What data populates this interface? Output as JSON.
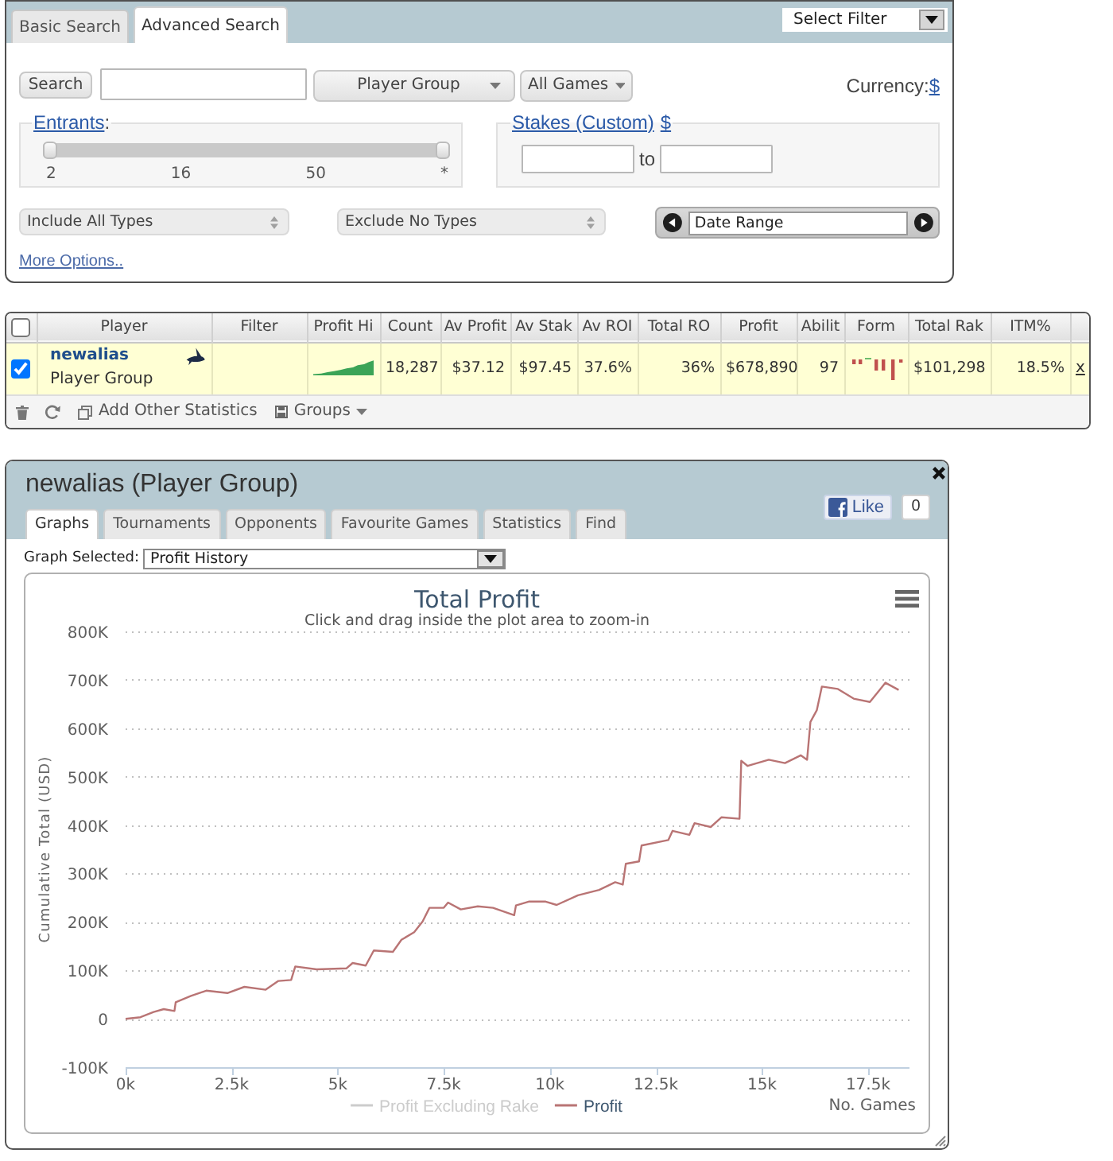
{
  "search_panel": {
    "tabs": [
      {
        "label": "Basic Search",
        "selected": false
      },
      {
        "label": "Advanced Search",
        "selected": true
      }
    ],
    "filter_select": "Select Filter",
    "search_button": "Search",
    "group_dropdown": "Player Group",
    "games_dropdown": "All Games",
    "currency": {
      "label": "Currency:",
      "link": "$"
    },
    "entrants": {
      "link": "Entrants",
      "suffix": ":",
      "handles": [
        {
          "level": 0
        },
        {
          "level": 1
        }
      ],
      "ticks": [
        "2",
        "16",
        "50",
        "*"
      ]
    },
    "stakes": {
      "link": "Stakes (Custom)",
      "currency_link": "$",
      "separator": "to"
    },
    "include_types": "Include All Types",
    "exclude_types": "Exclude No Types",
    "date_range": "Date Range",
    "more_options": "More Options.."
  },
  "stats_table": {
    "all_selected": false,
    "columns": [
      "Player",
      "Filter",
      "Profit Hi",
      "Count",
      "Av Profit",
      "Av Stak",
      "Av ROI",
      "Total RO",
      "Profit",
      "Abilit",
      "Form",
      "Total Rak",
      "ITM%"
    ],
    "rows": [
      {
        "selected": true,
        "cells": [
          {
            "kind": "player",
            "name": "newalias",
            "group": "Player Group"
          },
          {
            "kind": "empty"
          },
          {
            "kind": "sparkline"
          },
          {
            "kind": "number",
            "text": "18,287"
          },
          {
            "kind": "number",
            "text": "$37.12"
          },
          {
            "kind": "number",
            "text": "$97.45"
          },
          {
            "kind": "number",
            "text": "37.6%"
          },
          {
            "kind": "number",
            "text": "36%"
          },
          {
            "kind": "number",
            "text": "$678,890"
          },
          {
            "kind": "number",
            "text": "97"
          },
          {
            "kind": "form"
          },
          {
            "kind": "number",
            "text": "$101,298"
          },
          {
            "kind": "number",
            "text": "18.5%"
          },
          {
            "kind": "link",
            "text": "x"
          }
        ]
      }
    ],
    "toolbar": {
      "add_statistics": "Add Other Statistics",
      "groups": "Groups"
    }
  },
  "player_panel": {
    "title": "newalias (Player Group)",
    "tabs": [
      {
        "label": "Graphs",
        "selected": true
      },
      {
        "label": "Tournaments",
        "selected": false
      },
      {
        "label": "Opponents",
        "selected": false
      },
      {
        "label": "Favourite Games",
        "selected": false
      },
      {
        "label": "Statistics",
        "selected": false
      },
      {
        "label": "Find",
        "selected": false
      }
    ],
    "like": {
      "label": "Like",
      "count": "0"
    },
    "graph_select": {
      "label": "Graph Selected:",
      "value": "Profit History"
    },
    "graph": {
      "subtitle": "Click and drag inside the plot area to zoom-in",
      "chart_data": {
        "type": "line",
        "title": "Total Profit",
        "xlabel": "No. Games",
        "ylabel": "Cumulative Total (USD)",
        "grid": true,
        "x": [
          0,
          350,
          660,
          900,
          1150,
          1180,
          1540,
          1900,
          2400,
          2800,
          3300,
          3600,
          3900,
          4000,
          4500,
          5200,
          5350,
          5660,
          5850,
          6300,
          6500,
          6800,
          7000,
          7160,
          7500,
          7600,
          7900,
          8300,
          8660,
          9160,
          9200,
          9500,
          9900,
          10160,
          10660,
          11160,
          11540,
          11720,
          11790,
          12100,
          12160,
          12790,
          12890,
          13290,
          13410,
          13790,
          14040,
          14470,
          14510,
          14660,
          15160,
          15540,
          15910,
          16060,
          16140,
          16290,
          16410,
          16790,
          17160,
          17540,
          17790,
          17910,
          18220
        ],
        "series": [
          {
            "name": "Profit Excluding Rake",
            "color": "#cccccc",
            "values": [
              null,
              null,
              null,
              null,
              null,
              null,
              null,
              null,
              null,
              null,
              null,
              null,
              null,
              null,
              null,
              null,
              null,
              null,
              null,
              null,
              null,
              null,
              null,
              null,
              null,
              null,
              null,
              null,
              null,
              null,
              null,
              null,
              null,
              null,
              null,
              null,
              null,
              null,
              null,
              null,
              null,
              null,
              null,
              null,
              null,
              null,
              null,
              null,
              null,
              null,
              null,
              null,
              null,
              null,
              null,
              null,
              null,
              null,
              null,
              null,
              null,
              null,
              null
            ]
          },
          {
            "name": "Profit",
            "color": "#b97474",
            "values": [
              0,
              3000,
              14000,
              20000,
              16000,
              34000,
              47000,
              58000,
              53000,
              66000,
              60000,
              78000,
              80000,
              108000,
              102000,
              104000,
              115000,
              110000,
              141000,
              138000,
              163000,
              179000,
              201000,
              229000,
              229000,
              240000,
              226000,
              232000,
              229000,
              214000,
              234000,
              242000,
              242000,
              235000,
              255000,
              266000,
              282000,
              277000,
              320000,
              325000,
              358000,
              369000,
              388000,
              380000,
              404000,
              396000,
              416000,
              413000,
              533000,
              522000,
              535000,
              528000,
              544000,
              535000,
              613000,
              637000,
              686000,
              681000,
              661000,
              654000,
              681000,
              694000,
              679000
            ]
          }
        ],
        "xlim": [
          0,
          18400
        ],
        "ylim": [
          -100000,
          800000
        ],
        "xticks": [
          {
            "value": 0,
            "label": "0k"
          },
          {
            "value": 2500,
            "label": "2.5k"
          },
          {
            "value": 5000,
            "label": "5k"
          },
          {
            "value": 7500,
            "label": "7.5k"
          },
          {
            "value": 10000,
            "label": "10k"
          },
          {
            "value": 12500,
            "label": "12.5k"
          },
          {
            "value": 15000,
            "label": "15k"
          },
          {
            "value": 17500,
            "label": "17.5k"
          }
        ],
        "yticks": [
          {
            "value": -100000,
            "label": "-100K"
          },
          {
            "value": 0,
            "label": "0"
          },
          {
            "value": 100000,
            "label": "100K"
          },
          {
            "value": 200000,
            "label": "200K"
          },
          {
            "value": 300000,
            "label": "300K"
          },
          {
            "value": 400000,
            "label": "400K"
          },
          {
            "value": 500000,
            "label": "500K"
          },
          {
            "value": 600000,
            "label": "600K"
          },
          {
            "value": 700000,
            "label": "700K"
          },
          {
            "value": 800000,
            "label": "800K"
          }
        ]
      }
    }
  }
}
